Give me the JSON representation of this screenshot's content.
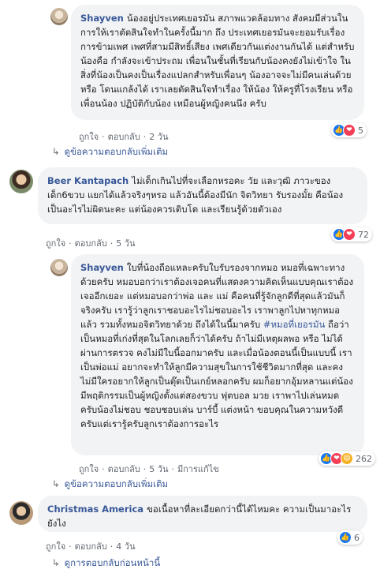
{
  "comments": [
    {
      "author": "Shayven",
      "text": "น้องอยู่ประเทศเยอรมัน สภาพแวดล้อมทาง สังคมมีส่วนในการให้เราตัดสินใจทำในครั้งนี้มาก ถึง ประเทศเยอรมันจะยอมรับเรื่องการข้ามเพศ เพศที่สามมีสิทธิ์เสียง เพศเดียวกันแต่งงานกันได้ แต่สำหรับน้องคือ กำลังจะเข้าประถม เพื่อนในชั้นที่เรียนกับน้องคงยังไม่เข้าใจ ในสิ่งที่น้องเป็นคงเป็นเรื่องแปลกสำหรับเพื่อนๆ น้องอาจจะไม่มีคนเล่นด้วย หรือ โดนแกล้งได้ เราเลยตัดสินใจทำเรื่อง ให้น้อง ให้ครูที่โรงเรียน หรือ เพื่อนน้อง ปฏิบัติกับน้อง เหมือนผู้หญิงคนนึง ครับ",
      "like": "ถูกใจ",
      "reply": "ตอบกลับ",
      "time": "2 วัน",
      "reactions": 5
    },
    {
      "author": "Beer Kantapach",
      "text": "ไม่เด็กเกินไปที่จะเลือกหรอคะ วัย และวุฒิ ภาวะของเด็ก6ขวบ แยกได้แล้วจริงๆหรอ แล้วอันนี้ต้องมีนัก จิตวิทยา รับรองมั้ย คือน้องเป็นอะไรไม่ผิดนะคะ แต่น้องควรเติบโต และเรียนรู้ด้วยตัวเอง",
      "like": "ถูกใจ",
      "reply": "ตอบกลับ",
      "time": "5 วัน",
      "reactions": 72
    },
    {
      "author": "Shayven",
      "text_before": "ใบที่น้องถือแหละครับใบรับรองจากหมอ หมอที่เฉพาะทางด้วยครับ หมอบอกว่าเราต้องเจอคนที่แสดงความคิดเห็นแบบคุณเราต้องเจออีกเยอะ แต่หมอบอกว่าพ่อ และ แม่ คือคนที่รู้จักลูกดีที่สุดแล้วมันก็จริงครับ เรารู้ว่าลูกเราชอบอะไรไม่ชอบอะไร เราพาลูกไปหาทุกหมอ แล้ว รวมทั้งหมอจิตวิทยาด้วย ถึงได้ในนี้มาครับ",
      "hashtag": "#หมอที่เยอรมัน",
      "text_after": "ถือว่าเป็นหมอที่เก่งที่สุดในโลกเลยก็ว่าได้ครับ ถ้าไม่มีเหตุผลพอ หรือ ไม่ได้ผ่านการตรวจ คงไม่มีใบนี้ออกมาครับ และเมื่อน้องตอนนี้เป็นแบบนี้ เราเป็นพ่อแม่ อยากจะทำให้ลูกมีความสุขในการใช้ชีวิตมากที่สุด และคงไม่มีใครอยากให้ลูกเป็นตุ๊ดเป็นเกย์หลอกครับ ผมก็อยากอุ้มหลานแต่น้องมีพฤติกรรมเป็นผู้หญิงตั้งแต่สองขวบ ฟุตบอล มวย เราพาไปเล่นหมดครับน้องไม่ชอบ ชอบชอบเล่น บาร์บี้ แต่งหน้า ขอบคุณในความหวังดีครับแต่เรารู้ครับลูกเราต้องการอะไร",
      "like": "ถูกใจ",
      "reply": "ตอบกลับ",
      "time": "5 วัน",
      "edited": "มีการแก้ไข",
      "reactions": 262
    },
    {
      "author": "Christmas America",
      "text": "ขอเนื้อหาที่ละเอียดกว่านี้ได้ไหมคะ ความเป็นมาอะไร ยังไง",
      "like": "ถูกใจ",
      "reply": "ตอบกลับ",
      "time": "4 วัน",
      "reactions": 6
    }
  ],
  "more_replies_label": "ดูข้อความตอบกลับเพิ่มเติม",
  "more_replies_label_2": "ดูข้อความตอบกลับเพิ่มเติม",
  "previous_replies_label": "ดูการตอบกลับก่อนหน้านี้",
  "colors": {
    "link": "#385898",
    "bubble": "#f2f3f5",
    "meta": "#606770",
    "like": "#1877f2",
    "love": "#f33e58",
    "haha": "#f7b125"
  }
}
